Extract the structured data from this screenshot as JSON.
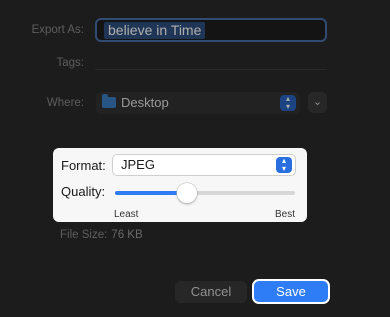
{
  "export": {
    "label": "Export As:",
    "value": "believe in Time"
  },
  "tags": {
    "label": "Tags:"
  },
  "where": {
    "label": "Where:",
    "value": "Desktop",
    "expand_icon": "chevron-down"
  },
  "format": {
    "label": "Format:",
    "value": "JPEG"
  },
  "quality": {
    "label": "Quality:",
    "level": 0.4,
    "min_label": "Least",
    "max_label": "Best"
  },
  "filesize": {
    "label": "File Size:",
    "value": "76 KB"
  },
  "buttons": {
    "cancel": "Cancel",
    "save": "Save"
  },
  "colors": {
    "accent": "#2f7df6",
    "background": "#2a2a2a"
  }
}
